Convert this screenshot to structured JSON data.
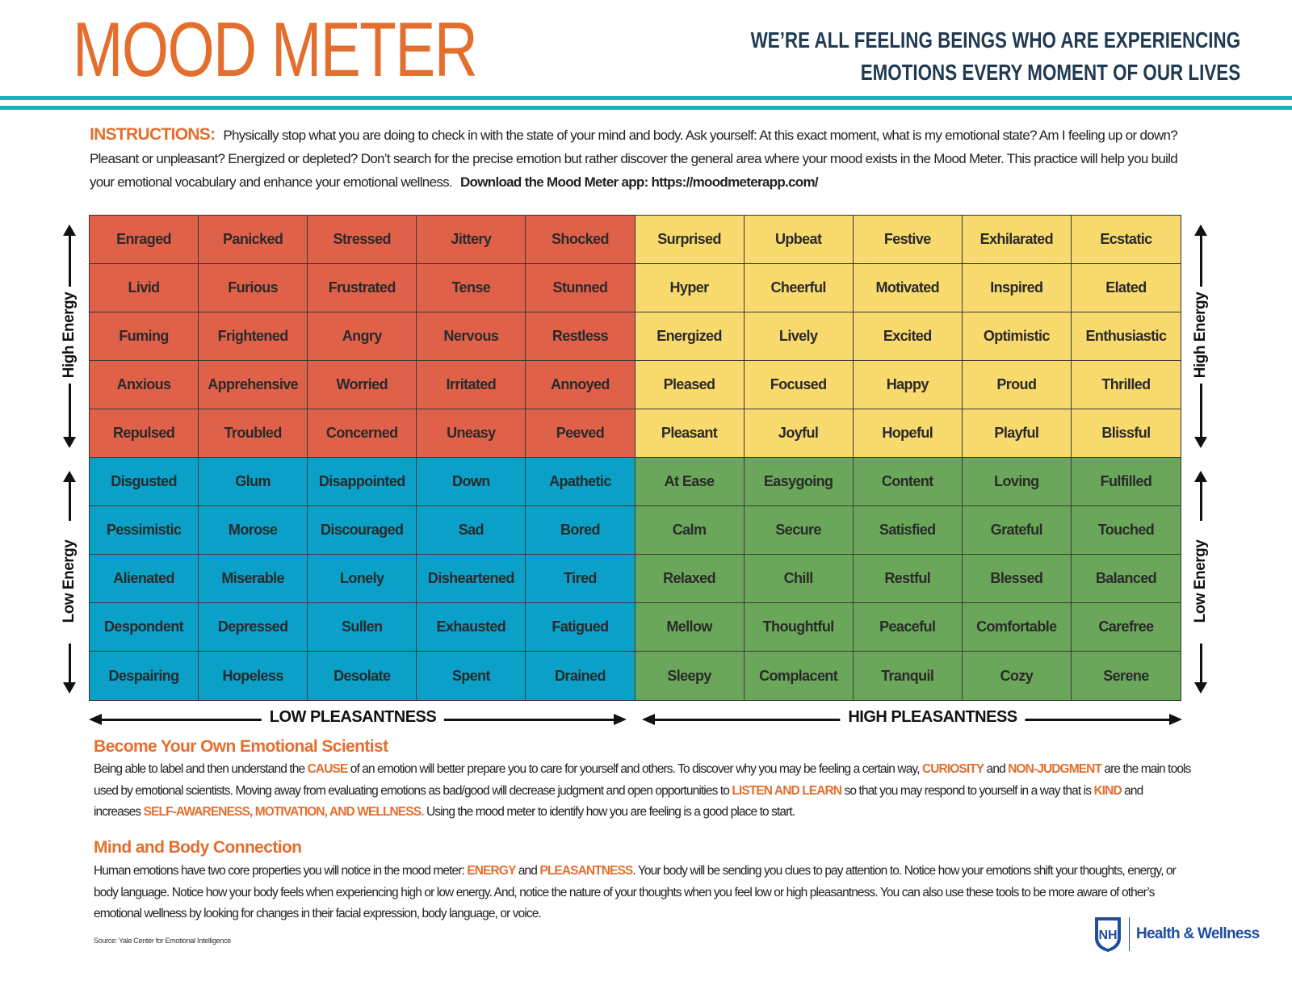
{
  "header": {
    "title": "MOOD METER",
    "tagline_1": "WE’RE ALL FEELING BEINGS WHO ARE EXPERIENCING",
    "tagline_2": "EMOTIONS EVERY MOMENT OF OUR LIVES"
  },
  "instructions": {
    "label": "INSTRUCTIONS:",
    "text": "Physically stop what you are doing to check in with the state of your mind and body. Ask yourself: At this exact moment, what is my emotional state? Am I feeling up or down? Pleasant or unpleasant? Energized or depleted?  Don’t search for the precise emotion but rather discover the general area where your mood exists in the Mood Meter. This practice will help you build your emotional vocabulary and enhance your emotional wellness.",
    "download": "Download the Mood Meter app: https://moodmeterapp.com/"
  },
  "colors": {
    "red": "#E0614A",
    "yellow": "#F9DA6E",
    "blue": "#0AA0C8",
    "green": "#6BA75A",
    "orange": "#E46E2E",
    "teal": "#17B5BB",
    "navy": "#1F3A52"
  },
  "grid": [
    [
      "Enraged",
      "Panicked",
      "Stressed",
      "Jittery",
      "Shocked",
      "Surprised",
      "Upbeat",
      "Festive",
      "Exhilarated",
      "Ecstatic"
    ],
    [
      "Livid",
      "Furious",
      "Frustrated",
      "Tense",
      "Stunned",
      "Hyper",
      "Cheerful",
      "Motivated",
      "Inspired",
      "Elated"
    ],
    [
      "Fuming",
      "Frightened",
      "Angry",
      "Nervous",
      "Restless",
      "Energized",
      "Lively",
      "Excited",
      "Optimistic",
      "Enthusiastic"
    ],
    [
      "Anxious",
      "Apprehensive",
      "Worried",
      "Irritated",
      "Annoyed",
      "Pleased",
      "Focused",
      "Happy",
      "Proud",
      "Thrilled"
    ],
    [
      "Repulsed",
      "Troubled",
      "Concerned",
      "Uneasy",
      "Peeved",
      "Pleasant",
      "Joyful",
      "Hopeful",
      "Playful",
      "Blissful"
    ],
    [
      "Disgusted",
      "Glum",
      "Disappointed",
      "Down",
      "Apathetic",
      "At Ease",
      "Easygoing",
      "Content",
      "Loving",
      "Fulfilled"
    ],
    [
      "Pessimistic",
      "Morose",
      "Discouraged",
      "Sad",
      "Bored",
      "Calm",
      "Secure",
      "Satisfied",
      "Grateful",
      "Touched"
    ],
    [
      "Alienated",
      "Miserable",
      "Lonely",
      "Disheartened",
      "Tired",
      "Relaxed",
      "Chill",
      "Restful",
      "Blessed",
      "Balanced"
    ],
    [
      "Despondent",
      "Depressed",
      "Sullen",
      "Exhausted",
      "Fatigued",
      "Mellow",
      "Thoughtful",
      "Peaceful",
      "Comfortable",
      "Carefree"
    ],
    [
      "Despairing",
      "Hopeless",
      "Desolate",
      "Spent",
      "Drained",
      "Sleepy",
      "Complacent",
      "Tranquil",
      "Cozy",
      "Serene"
    ]
  ],
  "axes": {
    "high_energy": "High Energy",
    "low_energy": "Low Energy",
    "low_pleasantness": "LOW PLEASANTNESS",
    "high_pleasantness": "HIGH PLEASANTNESS"
  },
  "scientist": {
    "heading": "Become Your Own Emotional Scientist",
    "t1": "Being able to label and then understand the ",
    "h1": "CAUSE",
    "t2": " of an emotion will better prepare you to care for yourself and others. To discover why you may be feeling a certain way, ",
    "h2": "CURIOSITY",
    "t3": " and ",
    "h3": "NON-JUDGMENT",
    "t4": " are the main tools used by emotional scientists. Moving away from evaluating emotions as bad/good will decrease judgment and open opportunities to ",
    "h4": "LISTEN AND LEARN",
    "t5": " so that you may respond to yourself in a way that is ",
    "h5": "KIND",
    "t6": " and increases ",
    "h6": "SELF-AWARENESS, MOTIVATION, AND WELLNESS.",
    "t7": " Using the mood meter to identify how you are feeling is a good place to start."
  },
  "mindbody": {
    "heading": "Mind and Body Connection",
    "t1": "Human emotions have two core properties you will notice in the mood meter: ",
    "h1": "ENERGY",
    "t2": " and ",
    "h2": "PLEASANTNESS",
    "t3": ". Your body will be sending you clues to pay attention to. Notice how your emotions shift your thoughts, energy, or body language. Notice how your body feels when experiencing high or low energy. And, notice the nature of your thoughts when you feel low or high pleasantness. You can also use these tools to be more aware of other’s emotional wellness by looking for changes in their facial expression, body language, or voice."
  },
  "source": "Source: Yale Center for Emotional Intelligence",
  "logo": {
    "mark": "UNH",
    "text": "Health & Wellness"
  }
}
